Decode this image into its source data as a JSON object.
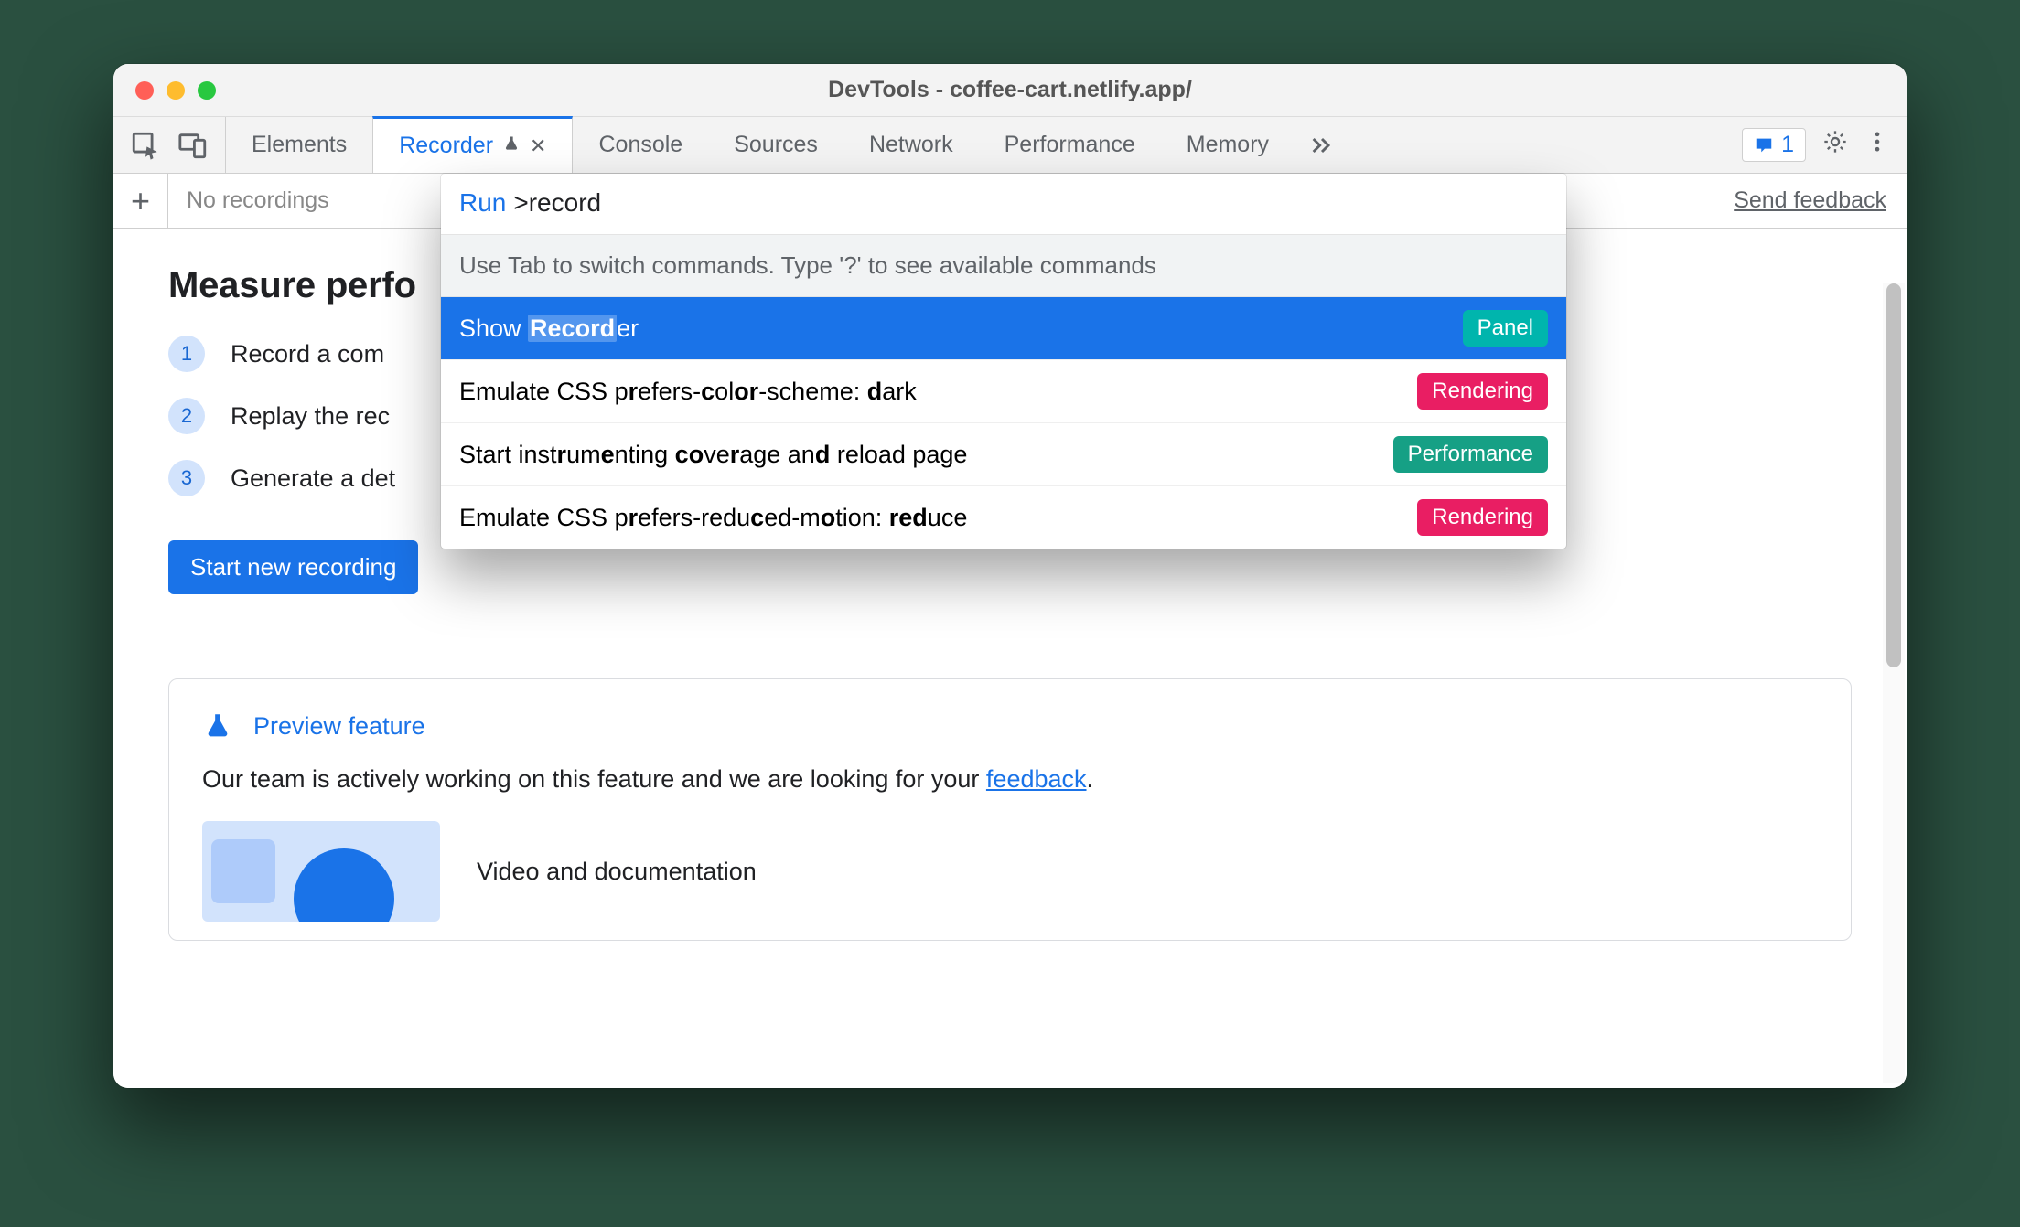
{
  "window": {
    "title": "DevTools - coffee-cart.netlify.app/"
  },
  "toolbar": {
    "tabs": [
      {
        "label": "Elements"
      },
      {
        "label": "Recorder",
        "selected": true,
        "experimental": true,
        "closable": true
      },
      {
        "label": "Console"
      },
      {
        "label": "Sources"
      },
      {
        "label": "Network"
      },
      {
        "label": "Performance"
      },
      {
        "label": "Memory"
      }
    ],
    "overflow_icon": ">>",
    "messages_count": "1"
  },
  "subbar": {
    "add": "+",
    "empty_label": "No recordings",
    "feedback": "Send feedback"
  },
  "page": {
    "heading": "Measure perfo",
    "steps": [
      "Record a com",
      "Replay the rec",
      "Generate a det"
    ],
    "start_button": "Start new recording",
    "preview": {
      "title": "Preview feature",
      "body_prefix": "Our team is actively working on this feature and we are looking for your ",
      "body_link": "feedback",
      "body_suffix": ".",
      "media_title": "Video and documentation"
    }
  },
  "command_menu": {
    "prefix": "Run",
    "query": ">record",
    "hint": "Use Tab to switch commands. Type '?' to see available commands",
    "items": [
      {
        "label_html": "Show <b>Record</b>er",
        "badge": "Panel",
        "badge_kind": "panel",
        "selected": true
      },
      {
        "label_html": "Emulate CSS p<b>r</b>efers-<b>c</b>ol<b>or</b>-scheme: <b>d</b>ark",
        "badge": "Rendering",
        "badge_kind": "rendering"
      },
      {
        "label_html": "Start inst<b>r</b>um<b>e</b>nting <b>co</b>ve<b>r</b>age an<b>d</b> reload page",
        "badge": "Performance",
        "badge_kind": "performance"
      },
      {
        "label_html": "Emulate CSS p<b>r</b>efers-redu<b>c</b>ed-m<b>o</b>tion: <b>red</b>uce",
        "badge": "Rendering",
        "badge_kind": "rendering"
      }
    ]
  }
}
